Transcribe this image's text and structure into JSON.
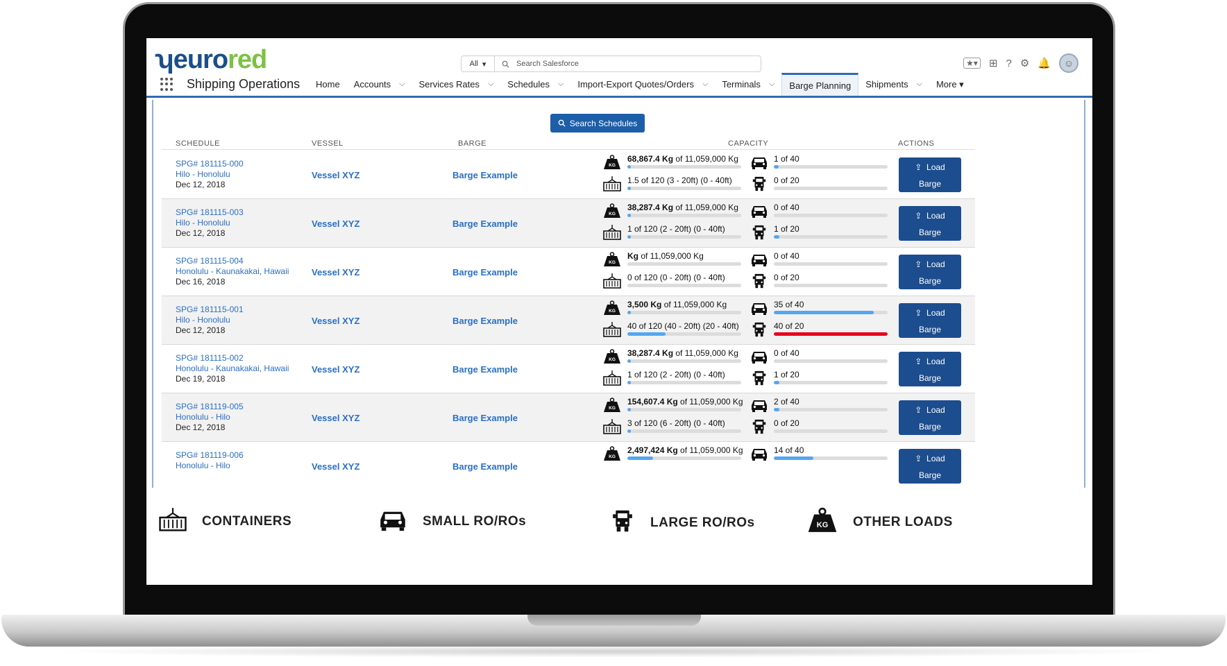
{
  "brand": {
    "logo_part1": "ʮeuro",
    "logo_part2": "red"
  },
  "search": {
    "scope": "All",
    "placeholder": "Search Salesforce"
  },
  "app": {
    "name": "Shipping Operations"
  },
  "nav": {
    "items": [
      {
        "label": "Home",
        "has_menu": false
      },
      {
        "label": "Accounts",
        "has_menu": true
      },
      {
        "label": "Services Rates",
        "has_menu": true
      },
      {
        "label": "Schedules",
        "has_menu": true
      },
      {
        "label": "Import-Export Quotes/Orders",
        "has_menu": true
      },
      {
        "label": "Terminals",
        "has_menu": true
      },
      {
        "label": "Barge Planning",
        "has_menu": false,
        "active": true
      },
      {
        "label": "Shipments",
        "has_menu": true
      },
      {
        "label": "More ▾",
        "has_menu": false
      }
    ]
  },
  "search_button": {
    "label": "Search Schedules"
  },
  "table": {
    "headers": {
      "schedule": "SCHEDULE",
      "vessel": "VESSEL",
      "barge": "BARGE",
      "capacity": "CAPACITY",
      "actions": "ACTIONS"
    },
    "load_label_1": "Load",
    "load_label_2": "Barge",
    "rows": [
      {
        "id": "SPG# 181115-000",
        "route": "Hilo - Honolulu",
        "date": "Dec 12, 2018",
        "vessel": "Vessel XYZ",
        "barge": "Barge Example",
        "weight_value": "68,867.4 Kg",
        "weight_of": " of 11,059,000 Kg",
        "weight_fill": 0.006,
        "small_text": "1 of 40",
        "small_fill": 0.025,
        "cont_text": "1.5 of 120  (3 - 20ft)  (0 - 40ft)",
        "cont_fill": 0.012,
        "large_text": "0 of 20",
        "large_fill": 0.0,
        "large_over": false
      },
      {
        "id": "SPG# 181115-003",
        "route": "Hilo - Honolulu",
        "date": "Dec 12, 2018",
        "vessel": "Vessel XYZ",
        "barge": "Barge Example",
        "weight_value": "38,287.4 Kg",
        "weight_of": " of 11,059,000 Kg",
        "weight_fill": 0.004,
        "small_text": "0 of 40",
        "small_fill": 0.0,
        "cont_text": "1 of 120  (2 - 20ft)  (0 - 40ft)",
        "cont_fill": 0.008,
        "large_text": "1 of 20",
        "large_fill": 0.05,
        "large_over": false
      },
      {
        "id": "SPG# 181115-004",
        "route": "Honolulu - Kaunakakai, Hawaii",
        "date": "Dec 16, 2018",
        "vessel": "Vessel XYZ",
        "barge": "Barge Example",
        "weight_value": "Kg",
        "weight_of": " of 11,059,000 Kg",
        "weight_fill": 0.0,
        "small_text": "0 of 40",
        "small_fill": 0.0,
        "cont_text": "0 of 120  (0 - 20ft)  (0 - 40ft)",
        "cont_fill": 0.0,
        "large_text": "0 of 20",
        "large_fill": 0.0,
        "large_over": false
      },
      {
        "id": "SPG# 181115-001",
        "route": "Hilo - Honolulu",
        "date": "Dec 12, 2018",
        "vessel": "Vessel XYZ",
        "barge": "Barge Example",
        "weight_value": "3,500 Kg",
        "weight_of": " of 11,059,000 Kg",
        "weight_fill": 0.0003,
        "small_text": "35 of 40",
        "small_fill": 0.875,
        "cont_text": "40 of 120  (40 - 20ft)  (20 - 40ft)",
        "cont_fill": 0.333,
        "large_text": "40 of 20",
        "large_fill": 1.0,
        "large_over": true
      },
      {
        "id": "SPG# 181115-002",
        "route": "Honolulu - Kaunakakai, Hawaii",
        "date": "Dec 19, 2018",
        "vessel": "Vessel XYZ",
        "barge": "Barge Example",
        "weight_value": "38,287.4 Kg",
        "weight_of": " of 11,059,000 Kg",
        "weight_fill": 0.004,
        "small_text": "0 of 40",
        "small_fill": 0.0,
        "cont_text": "1 of 120  (2 - 20ft)  (0 - 40ft)",
        "cont_fill": 0.008,
        "large_text": "1 of 20",
        "large_fill": 0.05,
        "large_over": false
      },
      {
        "id": "SPG# 181119-005",
        "route": "Honolulu - Hilo",
        "date": "Dec 12, 2018",
        "vessel": "Vessel XYZ",
        "barge": "Barge Example",
        "weight_value": "154,607.4 Kg",
        "weight_of": " of 11,059,000 Kg",
        "weight_fill": 0.014,
        "small_text": "2 of 40",
        "small_fill": 0.05,
        "cont_text": "3 of 120  (6 - 20ft)  (0 - 40ft)",
        "cont_fill": 0.025,
        "large_text": "0 of 20",
        "large_fill": 0.0,
        "large_over": false
      },
      {
        "id": "SPG# 181119-006",
        "route": "Honolulu - Hilo",
        "date": "",
        "vessel": "Vessel XYZ",
        "barge": "Barge Example",
        "weight_value": "2,497,424 Kg",
        "weight_of": " of 11,059,000 Kg",
        "weight_fill": 0.226,
        "small_text": "14 of 40",
        "small_fill": 0.35,
        "cont_text": "",
        "cont_fill": 0.0,
        "large_text": "",
        "large_fill": 0.0,
        "large_over": false
      }
    ]
  },
  "legend": {
    "containers": "CONTAINERS",
    "small": "SMALL RO/ROs",
    "large": "LARGE RO/ROs",
    "other": "OTHER LOADS"
  },
  "colors": {
    "accent": "#1d5ea8",
    "button": "#1c4d8e",
    "link": "#2a6fc6",
    "bar_fill": "#54a6f0",
    "bar_over": "#e8001c",
    "logo_blue": "#1a4f8a",
    "logo_green": "#7cc242"
  }
}
